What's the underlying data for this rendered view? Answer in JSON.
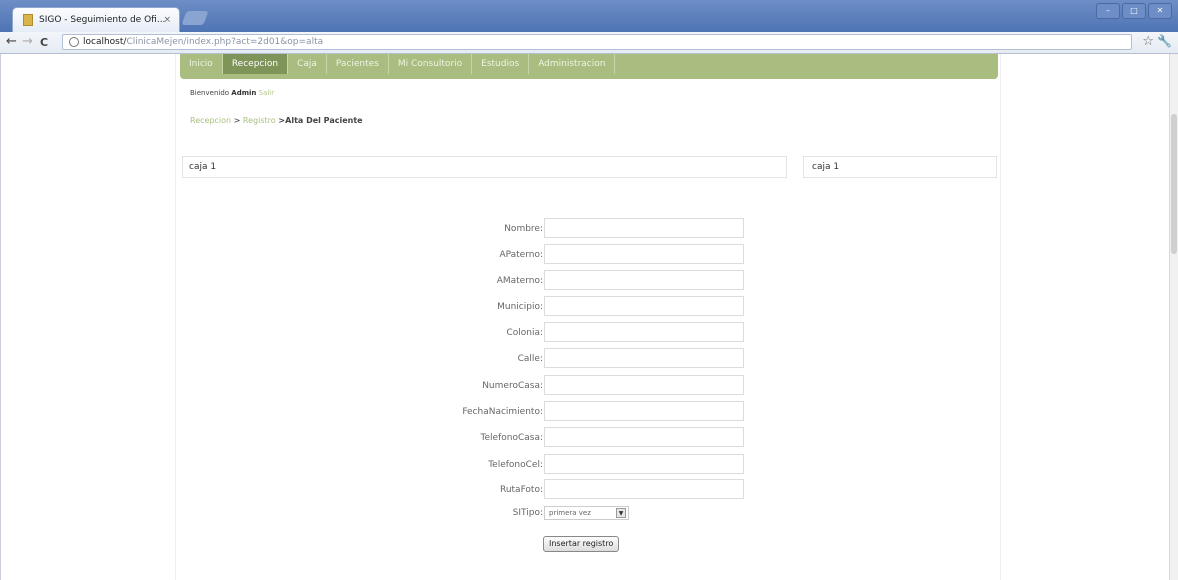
{
  "browser": {
    "tab_title": "SIGO - Seguimiento de Ofi...",
    "tab_close": "×",
    "url_host": "localhost/",
    "url_path": "ClinicaMejen/index.php?act=2d01&op=alta",
    "back": "←",
    "forward": "→",
    "reload": "C",
    "star": "☆",
    "wrench": "🔧",
    "window_controls": [
      "–",
      "□",
      "✕"
    ]
  },
  "menu": {
    "items": [
      "Inicio",
      "Recepcion",
      "Caja",
      "Pacientes",
      "Mi Consultorio",
      "Estudios",
      "Administracion"
    ],
    "active_index": 1
  },
  "welcome": {
    "prefix": "Bienvenido",
    "user": "Admin",
    "logout": "Salir"
  },
  "breadcrumb": {
    "crumb1": "Recepcion",
    "sep": " > ",
    "crumb2": "Registro",
    "current": " >Alta Del Paciente"
  },
  "cajas": {
    "left": "caja 1",
    "right": "caja 1"
  },
  "form": {
    "fields": [
      {
        "label": "Nombre:",
        "value": ""
      },
      {
        "label": "APaterno:",
        "value": ""
      },
      {
        "label": "AMaterno:",
        "value": ""
      },
      {
        "label": "Municipio:",
        "value": ""
      },
      {
        "label": "Colonia:",
        "value": ""
      },
      {
        "label": "Calle:",
        "value": ""
      },
      {
        "label": "NumeroCasa:",
        "value": ""
      },
      {
        "label": "FechaNacimiento:",
        "value": ""
      },
      {
        "label": "TelefonoCasa:",
        "value": ""
      },
      {
        "label": "TelefonoCel:",
        "value": ""
      },
      {
        "label": "RutaFoto:",
        "value": ""
      }
    ],
    "tipo_label": "SITipo:",
    "tipo_selected": "primera vez",
    "submit_label": "Insertar registro"
  },
  "colors": {
    "menu_bg": "#a9bd80",
    "menu_active": "#7f9458",
    "link": "#a8bf7c"
  }
}
